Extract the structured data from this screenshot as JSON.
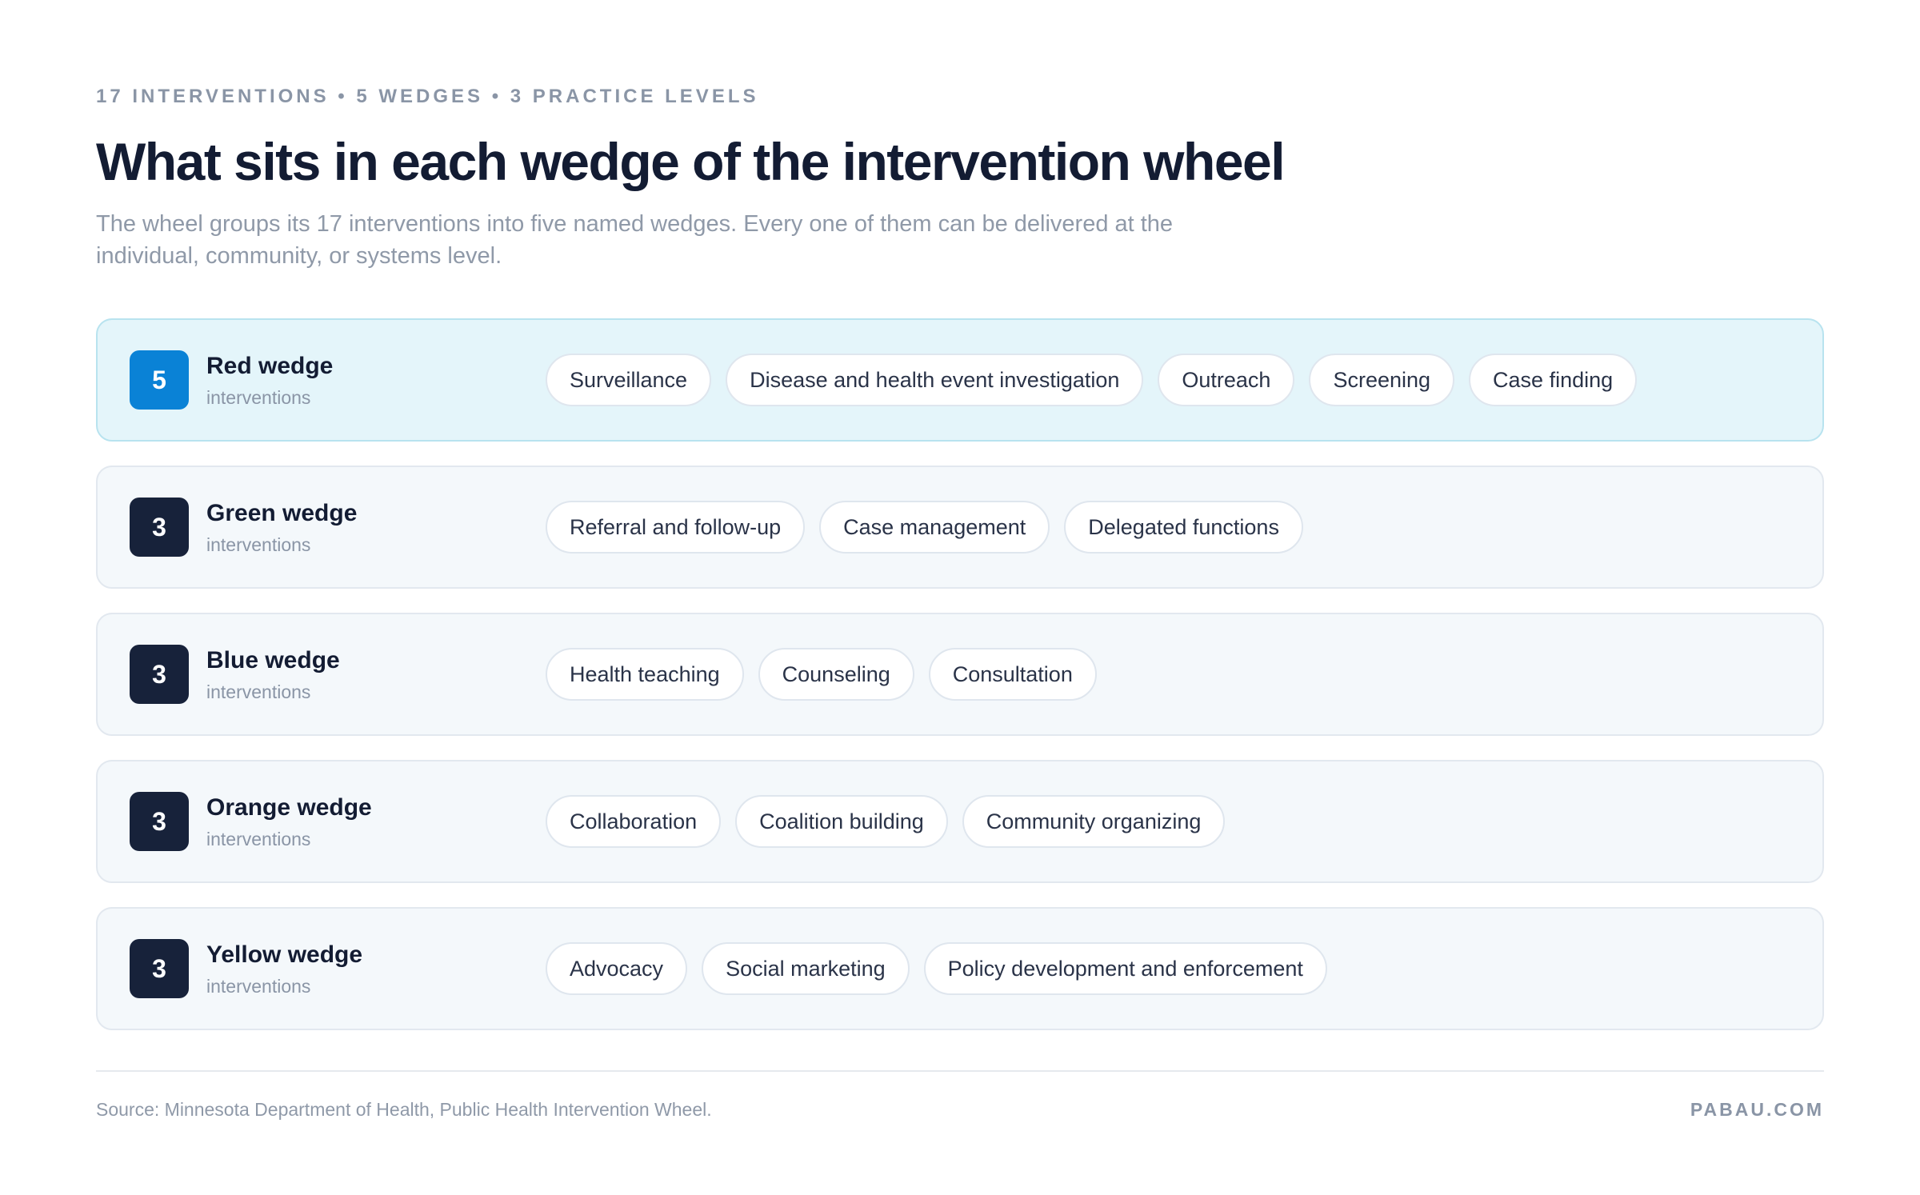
{
  "header": {
    "eyebrow": "17 INTERVENTIONS • 5 WEDGES • 3 PRACTICE LEVELS",
    "title": "What sits in each wedge of the intervention wheel",
    "subtitle": "The wheel groups its 17 interventions into five named wedges. Every one of them can be delivered at the individual, community, or systems level."
  },
  "wedges": [
    {
      "count": "5",
      "name": "Red wedge",
      "sub": "interventions",
      "highlighted": true,
      "interventions": [
        "Surveillance",
        "Disease and health event investigation",
        "Outreach",
        "Screening",
        "Case finding"
      ]
    },
    {
      "count": "3",
      "name": "Green wedge",
      "sub": "interventions",
      "highlighted": false,
      "interventions": [
        "Referral and follow-up",
        "Case management",
        "Delegated functions"
      ]
    },
    {
      "count": "3",
      "name": "Blue wedge",
      "sub": "interventions",
      "highlighted": false,
      "interventions": [
        "Health teaching",
        "Counseling",
        "Consultation"
      ]
    },
    {
      "count": "3",
      "name": "Orange wedge",
      "sub": "interventions",
      "highlighted": false,
      "interventions": [
        "Collaboration",
        "Coalition building",
        "Community organizing"
      ]
    },
    {
      "count": "3",
      "name": "Yellow wedge",
      "sub": "interventions",
      "highlighted": false,
      "interventions": [
        "Advocacy",
        "Social marketing",
        "Policy development and enforcement"
      ]
    }
  ],
  "footer": {
    "source": "Source: Minnesota Department of Health, Public Health Intervention Wheel.",
    "brand": "PABAU.COM"
  },
  "colors": {
    "highlight_badge": "#0a82d6",
    "highlight_row": "#e4f5fa",
    "badge": "#17223a"
  }
}
